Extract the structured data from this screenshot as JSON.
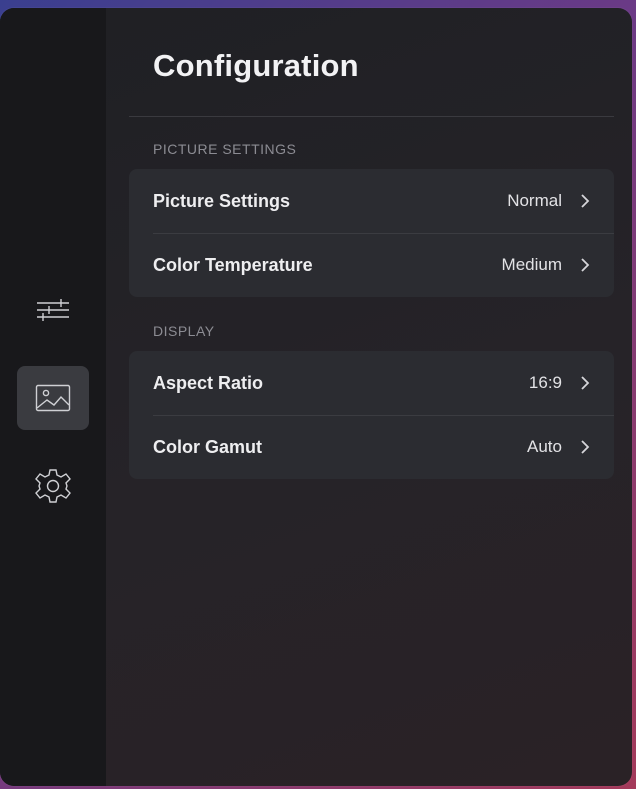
{
  "header": {
    "title": "Configuration"
  },
  "rail": {
    "items": [
      {
        "name": "adjustments",
        "icon": "sliders-icon",
        "active": false
      },
      {
        "name": "picture",
        "icon": "image-icon",
        "active": true
      },
      {
        "name": "settings",
        "icon": "gear-icon",
        "active": false
      }
    ]
  },
  "sections": [
    {
      "label": "PICTURE SETTINGS",
      "rows": [
        {
          "label": "Picture Settings",
          "value": "Normal"
        },
        {
          "label": "Color Temperature",
          "value": "Medium"
        }
      ]
    },
    {
      "label": "DISPLAY",
      "rows": [
        {
          "label": "Aspect Ratio",
          "value": "16:9"
        },
        {
          "label": "Color Gamut",
          "value": "Auto"
        }
      ]
    }
  ],
  "colors": {
    "background": "#1f2024",
    "rail": "#18181b",
    "card": "#2b2c31",
    "active_rail_item": "#3a3b40",
    "text": "#eeeef0",
    "muted": "#8c8c93"
  }
}
